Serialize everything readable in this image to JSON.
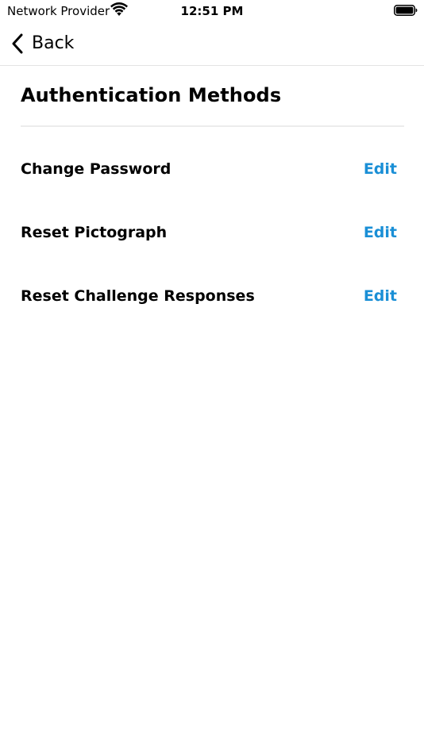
{
  "status_bar": {
    "carrier": "Network Provider",
    "time": "12:51 PM",
    "wifi_icon": "wifi-icon",
    "battery_icon": "battery-icon"
  },
  "nav": {
    "back_label": "Back",
    "back_icon": "chevron-left-icon"
  },
  "page": {
    "title": "Authentication Methods"
  },
  "methods": [
    {
      "label": "Change Password",
      "action": "Edit"
    },
    {
      "label": "Reset Pictograph",
      "action": "Edit"
    },
    {
      "label": "Reset Challenge Responses",
      "action": "Edit"
    }
  ],
  "colors": {
    "accent": "#1a8fd6",
    "text": "#000000",
    "divider": "#ececec",
    "background": "#ffffff"
  }
}
